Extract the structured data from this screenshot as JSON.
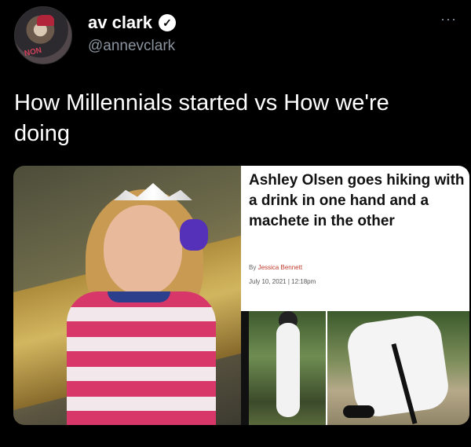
{
  "tweet": {
    "display_name": "av clark",
    "handle": "@annevclark",
    "verified_mark": "✓",
    "more_label": "···",
    "text": "How Millennials started vs How we're doing",
    "avatar_label": "NON"
  },
  "article": {
    "headline": "Ashley Olsen goes hiking with a drink in one hand and a machete in the other",
    "byline_prefix": "By",
    "author": "Jessica Bennett",
    "date": "July 10, 2021",
    "separator": "|",
    "time": "12:18pm"
  }
}
